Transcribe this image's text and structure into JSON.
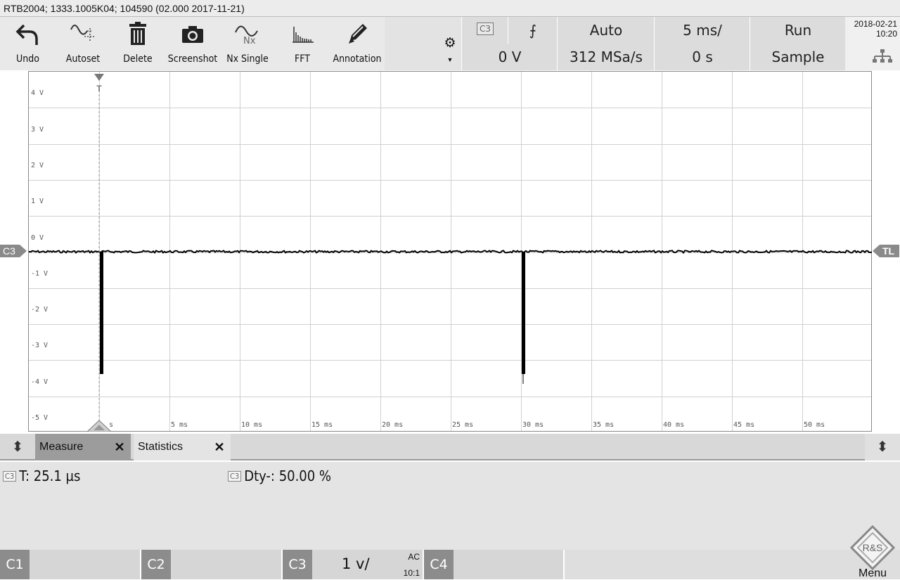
{
  "title": "RTB2004; 1333.1005K04; 104590 (02.000 2017-11-21)",
  "toolbar": {
    "buttons": [
      {
        "label": "Undo",
        "icon": "undo-icon"
      },
      {
        "label": "Autoset",
        "icon": "autoset-icon"
      },
      {
        "label": "Delete",
        "icon": "trash-icon"
      },
      {
        "label": "Screenshot",
        "icon": "camera-icon"
      },
      {
        "label": "Nx Single",
        "icon": "nx-single-icon"
      },
      {
        "label": "FFT",
        "icon": "fft-icon"
      },
      {
        "label": "Annotation",
        "icon": "pencil-icon"
      }
    ],
    "settings_icon": "gear-icon"
  },
  "trigger": {
    "source": "C3",
    "slope_symbol": "⨍",
    "level": "0 V",
    "mode": "Auto",
    "sample_rate": "312 MSa/s",
    "timebase": "5 ms/",
    "position": "0 s",
    "run_state": "Run",
    "acquisition": "Sample"
  },
  "clock": {
    "date": "2018-02-21",
    "time": "10:20"
  },
  "graph": {
    "y_labels": [
      "4 V",
      "3 V",
      "2 V",
      "1 V",
      "0 V",
      "-1 V",
      "-2 V",
      "-3 V",
      "-4 V",
      "-5 V"
    ],
    "x_labels": [
      "s",
      "5 ms",
      "10 ms",
      "15 ms",
      "20 ms",
      "25 ms",
      "30 ms",
      "35 ms",
      "40 ms",
      "45 ms",
      "50 ms"
    ],
    "channel_marker": "C3",
    "trigger_level_marker": "TL",
    "trigger_marker": "T",
    "trace_color": "#000000"
  },
  "tabs": [
    {
      "label": "Measure",
      "close": "✕"
    },
    {
      "label": "Statistics",
      "close": "✕"
    }
  ],
  "measurements": [
    {
      "chip": "C3",
      "text": "T: 25.1 µs"
    },
    {
      "chip": "C3",
      "text": "Dty-: 50.00 %"
    }
  ],
  "channels": [
    {
      "label": "C1",
      "scale": "",
      "coupling": "",
      "probe": ""
    },
    {
      "label": "C2",
      "scale": "",
      "coupling": "",
      "probe": ""
    },
    {
      "label": "C3",
      "scale": "1 v/",
      "coupling": "AC",
      "probe": "10:1"
    },
    {
      "label": "C4",
      "scale": "",
      "coupling": "",
      "probe": ""
    }
  ],
  "menu": {
    "label": "Menu",
    "logo": "R&S"
  }
}
